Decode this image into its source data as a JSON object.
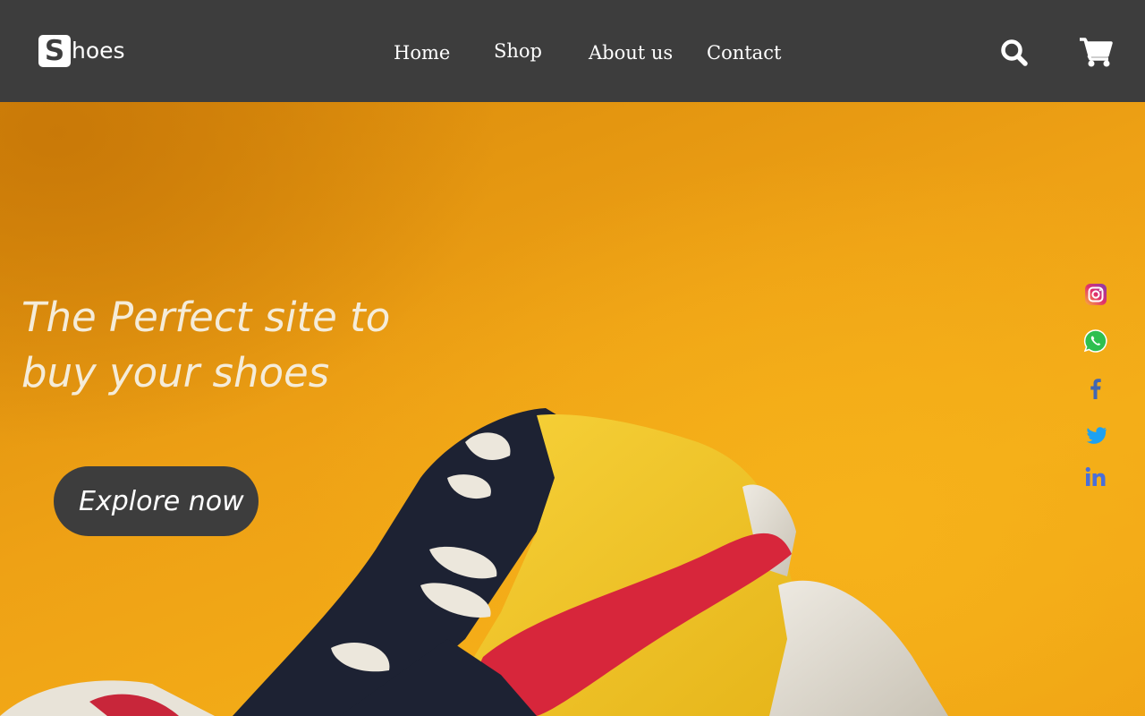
{
  "header": {
    "logo_mark": "S",
    "logo_text": "hoes",
    "nav": {
      "home": "Home",
      "shop": "Shop",
      "about": "About us",
      "contact": "Contact"
    },
    "icons": {
      "search": "search-icon",
      "cart": "cart-icon"
    }
  },
  "hero": {
    "title": "The Perfect site to buy your shoes",
    "cta_label": "Explore now"
  },
  "social": [
    "instagram-icon",
    "whatsapp-icon",
    "facebook-icon",
    "twitter-icon",
    "linkedin-icon"
  ],
  "colors": {
    "header_bg": "#3d3d3d",
    "hero_orange": "#f0a415",
    "button_bg": "#3d3d3d",
    "text_light": "#f5ecd9"
  }
}
